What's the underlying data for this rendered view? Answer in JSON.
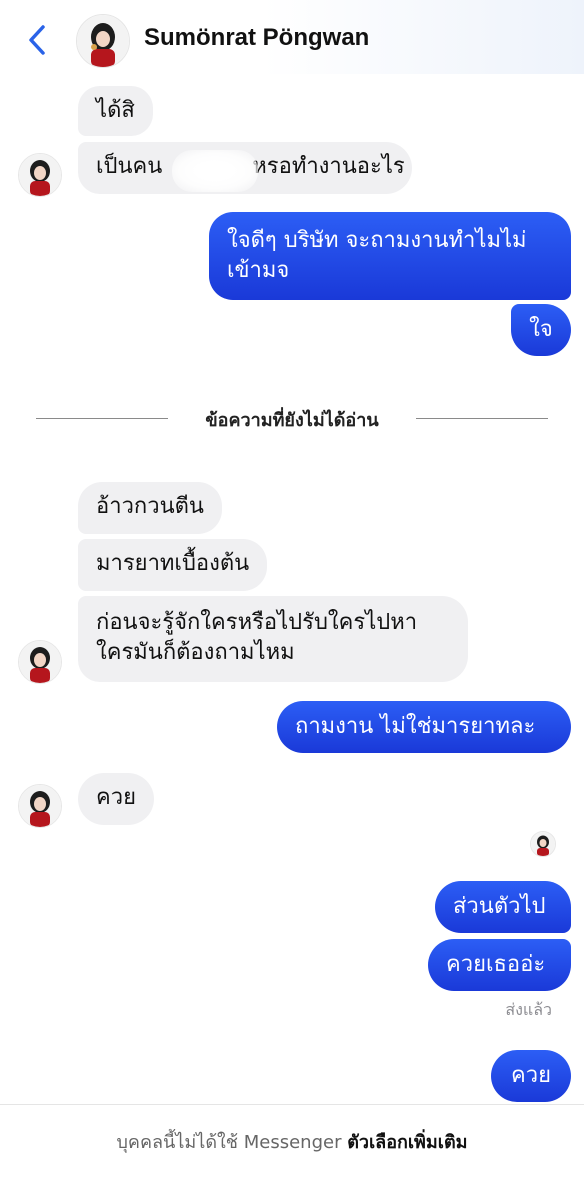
{
  "header": {
    "contact_name": "Sumönrat Pöngwan",
    "back_icon": "chevron-left-icon",
    "accent": "#2a63e8"
  },
  "messages": {
    "m1": "ได้สิ",
    "m2_start": "เป็นคน",
    "m2_end": "หรอทำงานอะไร",
    "m3": "ใจดีๆ บริษัท จะถามงานทำไมไม่เข้ามจ",
    "m4": "ใจ",
    "divider": "ข้อความที่ยังไม่ได้อ่าน",
    "m5": "อ้าวกวนตีน",
    "m6": "มารยาทเบื้องต้น",
    "m7": "ก่อนจะรู้จักใครหรือไปรับใครไปหาใครมันก็ต้องถามไหม",
    "m8": "ถามงาน ไม่ใช่มารยาทละ",
    "m9": "ควย",
    "m10": "ส่วนตัวไป",
    "m11": "ควยเธออ่ะ",
    "status": "ส่งแล้ว",
    "m12": "ควย"
  },
  "footer": {
    "note": "บุคคลนี้ไม่ได้ใช้ Messenger",
    "link": "ตัวเลือกเพิ่มเติม"
  },
  "colors": {
    "incoming_bubble": "#f0f0f2",
    "outgoing_bubble": "#1f4be8"
  }
}
